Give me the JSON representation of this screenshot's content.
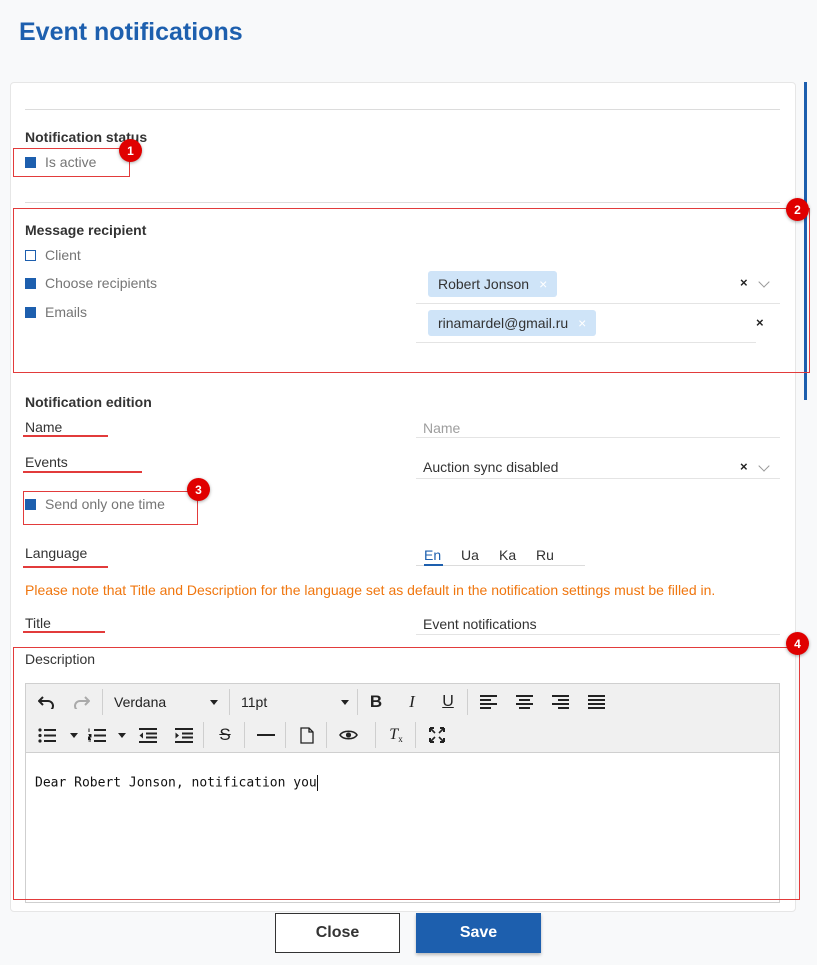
{
  "page": {
    "title": "Event notifications"
  },
  "status": {
    "title": "Notification status",
    "is_active_label": "Is active",
    "is_active_checked": true
  },
  "recipient": {
    "title": "Message recipient",
    "options": [
      {
        "label": "Client",
        "checked": false
      },
      {
        "label": "Choose recipients",
        "checked": true
      },
      {
        "label": "Emails",
        "checked": true
      }
    ],
    "recipients_tags": [
      "Robert Jonson"
    ],
    "email_tags": [
      "rinamardel@gmail.ru"
    ],
    "tag_remove_glyph": "×",
    "clear_glyph": "×"
  },
  "edition": {
    "title": "Notification edition",
    "name_label": "Name",
    "name_placeholder": "Name",
    "events_label": "Events",
    "events_value": "Auction sync disabled",
    "send_once_label": "Send only one time",
    "send_once_checked": true,
    "language_label": "Language",
    "languages": [
      "En",
      "Ua",
      "Ka",
      "Ru"
    ],
    "active_language": "En",
    "note": "Please note that Title and Description for the language set as default in the notification settings must be filled in.",
    "title_label": "Title",
    "title_value": "Event notifications",
    "description_label": "Description"
  },
  "editor": {
    "font": "Verdana",
    "size": "11pt",
    "content": "Dear Robert Jonson,  notification you",
    "tools": [
      "undo-icon",
      "redo-icon",
      "bold-icon",
      "italic-icon",
      "underline-icon",
      "align-left-icon",
      "align-center-icon",
      "align-right-icon",
      "align-justify-icon",
      "bullet-list-icon",
      "numbered-list-icon",
      "outdent-icon",
      "indent-icon",
      "strikethrough-icon",
      "horizontal-rule-icon",
      "new-document-icon",
      "preview-icon",
      "clear-format-icon",
      "fullscreen-icon"
    ]
  },
  "annotations": {
    "badges": [
      "1",
      "2",
      "3",
      "4"
    ],
    "color": "#e00000"
  },
  "actions": {
    "close_label": "Close",
    "save_label": "Save"
  },
  "colors": {
    "accent": "#1d5fae",
    "warning": "#f0760e",
    "annotation": "#e23b3b",
    "tag_bg": "#cfe4f8"
  }
}
